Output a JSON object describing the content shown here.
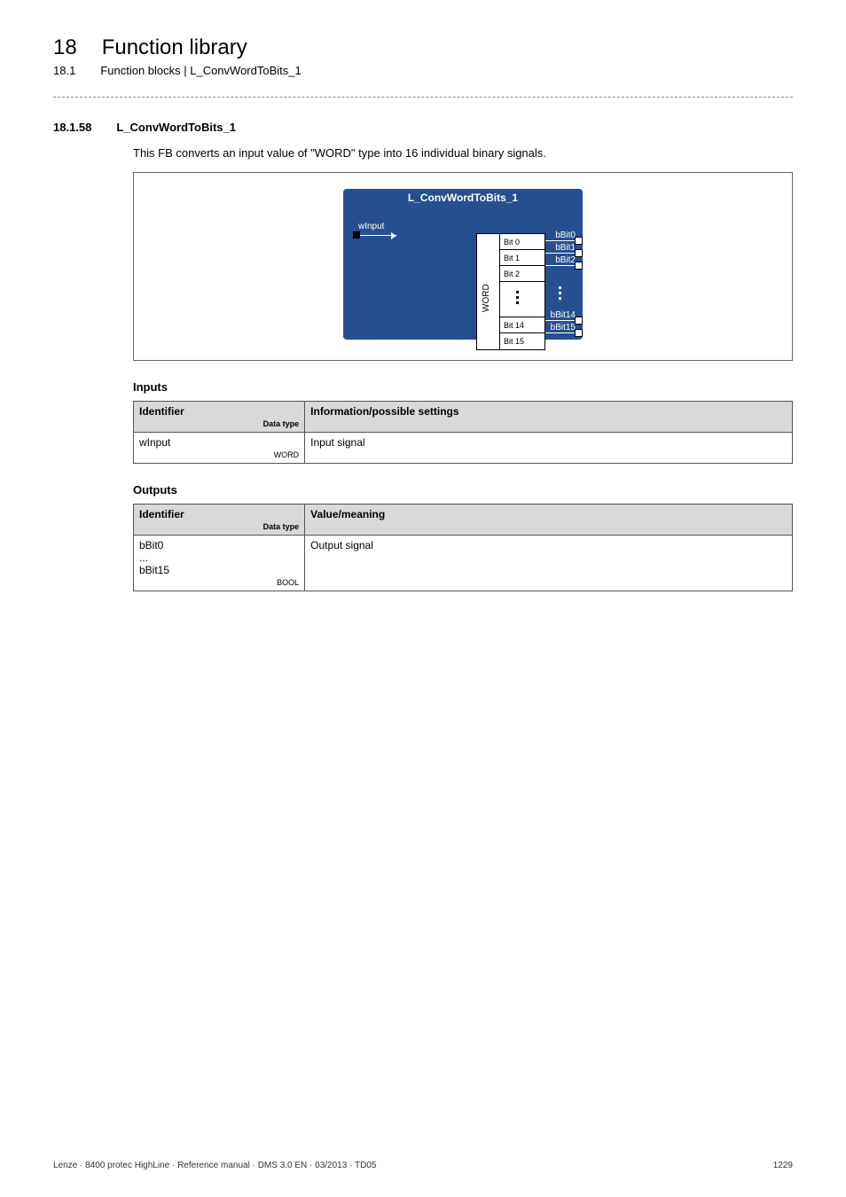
{
  "header": {
    "chapter_num": "18",
    "chapter_title": "Function library",
    "sub_num": "18.1",
    "sub_title": "Function blocks | L_ConvWordToBits_1"
  },
  "section": {
    "num": "18.1.58",
    "title": "L_ConvWordToBits_1",
    "description": "This FB converts an input value of \"WORD\" type into 16 individual binary signals."
  },
  "diagram": {
    "fb_title": "L_ConvWordToBits_1",
    "input_label": "wInput",
    "word_label": "WORD",
    "bits": {
      "b0": "Bit 0",
      "b1": "Bit 1",
      "b2": "Bit 2",
      "b14": "Bit 14",
      "b15": "Bit 15"
    },
    "outputs": {
      "o0": "bBit0",
      "o1": "bBit1",
      "o2": "bBit2",
      "o14": "bBit14",
      "o15": "bBit15"
    }
  },
  "inputs_heading": "Inputs",
  "inputs_table": {
    "h1": "Identifier",
    "h1_sub": "Data type",
    "h2": "Information/possible settings",
    "rows": [
      {
        "id": "wInput",
        "dtype": "WORD",
        "info": "Input signal"
      }
    ]
  },
  "outputs_heading": "Outputs",
  "outputs_table": {
    "h1": "Identifier",
    "h1_sub": "Data type",
    "h2": "Value/meaning",
    "rows": [
      {
        "id_line1": "bBit0",
        "id_line2": "...",
        "id_line3": "bBit15",
        "dtype": "BOOL",
        "info": "Output signal"
      }
    ]
  },
  "footer": {
    "left": "Lenze · 8400 protec HighLine · Reference manual · DMS 3.0 EN · 03/2013 · TD05",
    "right": "1229"
  }
}
